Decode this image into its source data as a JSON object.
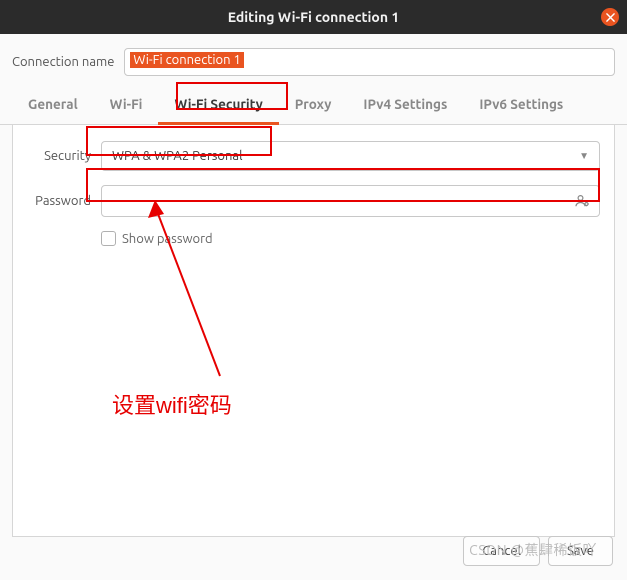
{
  "titlebar": {
    "title": "Editing Wi-Fi connection 1"
  },
  "connection": {
    "label": "Connection name",
    "value": "Wi-Fi connection 1"
  },
  "tabs": {
    "general": "General",
    "wifi": "Wi-Fi",
    "security": "Wi-Fi Security",
    "proxy": "Proxy",
    "ipv4": "IPv4 Settings",
    "ipv6": "IPv6 Settings"
  },
  "form": {
    "security_label": "Security",
    "security_value": "WPA & WPA2 Personal",
    "password_label": "Password",
    "password_value": "",
    "show_password": "Show password"
  },
  "footer": {
    "cancel": "Cancel",
    "save": "Save"
  },
  "annotation": {
    "text": "设置wifi密码"
  },
  "watermark": "CSDN @蕉肆稀饭吖"
}
